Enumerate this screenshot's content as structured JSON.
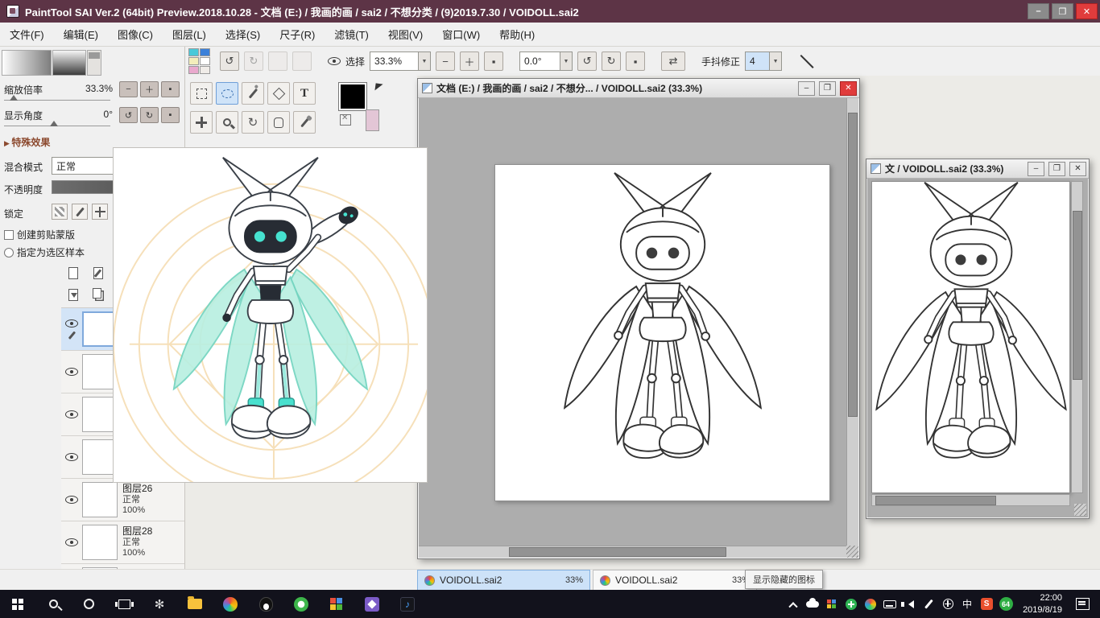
{
  "colors": {
    "titlebar": "#5d3446",
    "close_button": "#e03c3c",
    "active_tab": "#cde2f8",
    "character_accent": "#46e2d0",
    "wing_mint": "#b9efe1"
  },
  "window": {
    "title": "PaintTool SAI Ver.2 (64bit) Preview.2018.10.28 - 文档 (E:) / 我画的画 / sai2 / 不想分类 / (9)2019.7.30 / VOIDOLL.sai2",
    "minimize": "–",
    "maximize": "❐",
    "close": "✕"
  },
  "menu": [
    "文件(F)",
    "编辑(E)",
    "图像(C)",
    "图层(L)",
    "选择(S)",
    "尺子(R)",
    "滤镜(T)",
    "视图(V)",
    "窗口(W)",
    "帮助(H)"
  ],
  "toolbar": {
    "swatches": [
      "#49c9d9",
      "#3b80d9",
      "#f3eebb",
      "#ffffff",
      "#e9a9cd",
      "#f0ece8"
    ],
    "undo": "↺",
    "redo": "↻",
    "select_label": "选择",
    "zoom_value": "33.3%",
    "minus": "−",
    "plus": "＋",
    "reset": "▪",
    "angle_value": "0.0°",
    "rotate_ccw": "↺",
    "rotate_cw": "↻",
    "flip": "⇄",
    "stabilizer_label": "手抖修正",
    "stabilizer_value": "4",
    "dropdown_arrow": "▼"
  },
  "left_panel": {
    "zoom_label": "缩放倍率",
    "zoom_value": "33.3%",
    "angle_label": "显示角度",
    "angle_value": "0°",
    "effects_header": "特殊效果",
    "blend_label": "混合模式",
    "blend_value": "正常",
    "opacity_label": "不透明度",
    "lock_label": "锁定",
    "clipping_label": "创建剪贴蒙版",
    "selection_sample_label": "指定为选区样本",
    "layers": [
      {
        "name": "",
        "mode": "",
        "opacity": "",
        "selected": true,
        "pen": true
      },
      {
        "name": "",
        "mode": "",
        "opacity": "",
        "selected": false,
        "pen": false
      },
      {
        "name": "",
        "mode": "",
        "opacity": "",
        "selected": false,
        "pen": false
      },
      {
        "name": "",
        "mode": "",
        "opacity": "",
        "selected": false,
        "pen": false
      },
      {
        "name": "图层26",
        "mode": "正常",
        "opacity": "100%",
        "selected": false,
        "pen": false
      },
      {
        "name": "图层28",
        "mode": "正常",
        "opacity": "100%",
        "selected": false,
        "pen": false
      },
      {
        "name": "",
        "mode": "",
        "opacity": "",
        "selected": false,
        "pen": false
      }
    ]
  },
  "documents": {
    "main_title": "文档 (E:) / 我画的画 / sai2 / 不想分... / VOIDOLL.sai2 (33.3%)",
    "side_title": "文 / VOIDOLL.sai2 (33.3%)"
  },
  "tabs": [
    {
      "label": "VOIDOLL.sai2",
      "percent": "33%",
      "active": true
    },
    {
      "label": "VOIDOLL.sai2",
      "percent": "33%",
      "active": false
    }
  ],
  "tray_tooltip": "显示隐藏的图标",
  "taskbar": {
    "app_icons": [
      "pinwheel",
      "file-explorer",
      "sai",
      "qq",
      "green-browser",
      "color-blocks",
      "purple-app",
      "music-app"
    ],
    "tray_icons": [
      "chevron-up",
      "cloud",
      "color-grid",
      "green-plus",
      "color-ball",
      "keyboard",
      "volume",
      "pen",
      "crosshair",
      "ime",
      "sogou",
      "level-badge"
    ],
    "ime_label": "中",
    "sogou_label": "S",
    "badge_label": "64",
    "clock_time": "22:00",
    "clock_date": "2019/8/19"
  }
}
